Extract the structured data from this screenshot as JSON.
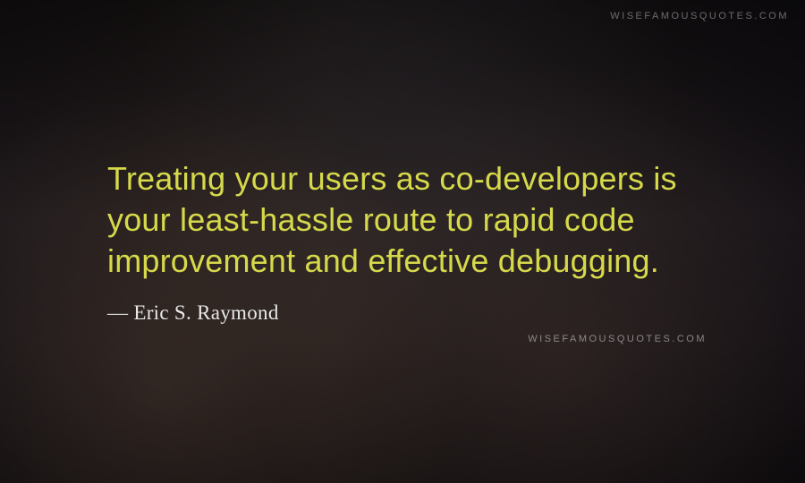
{
  "quote": {
    "text": "Treating your users as co-developers is your least-hassle route to rapid code improvement and effective debugging.",
    "author": "— Eric S. Raymond"
  },
  "watermark": {
    "text": "WISEFAMOUSQUOTES.COM"
  }
}
